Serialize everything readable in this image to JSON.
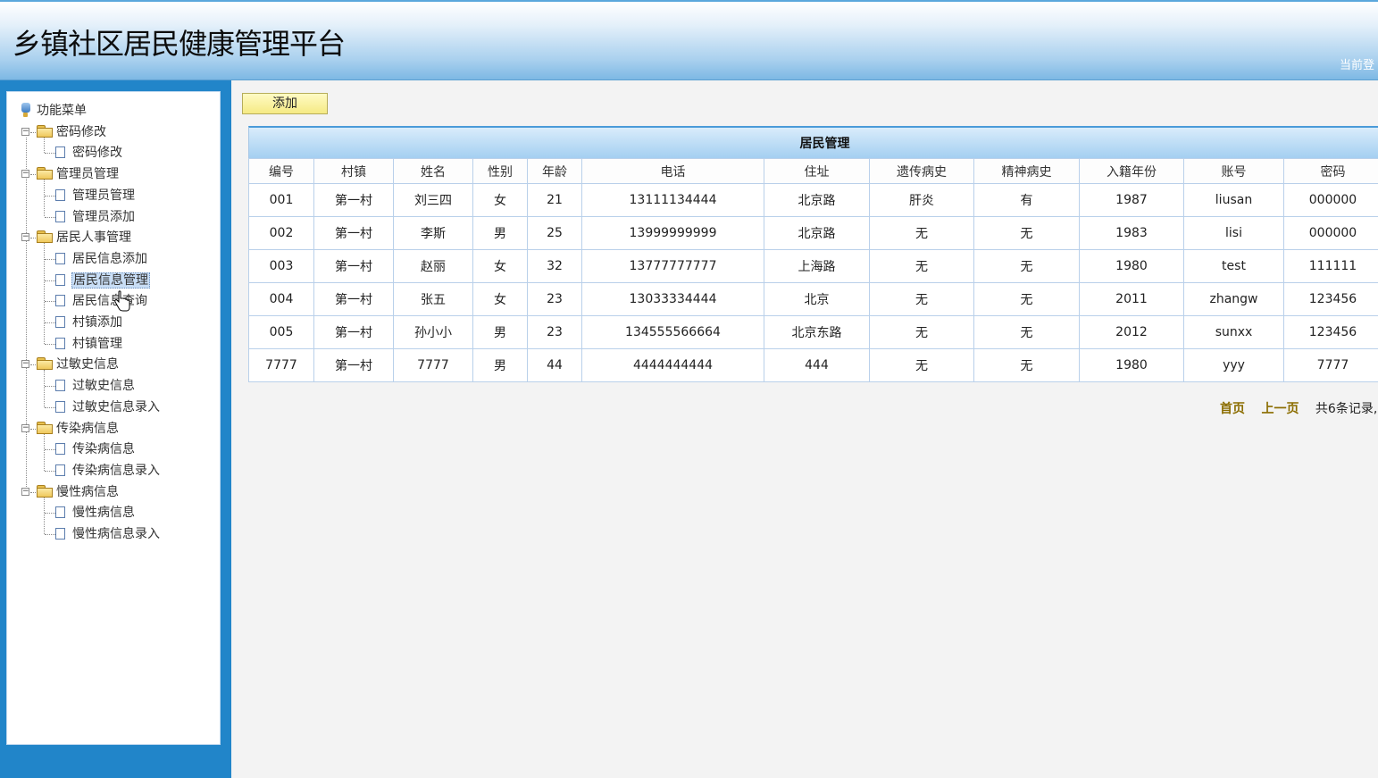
{
  "header": {
    "title": "乡镇社区居民健康管理平台",
    "login_info": "当前登"
  },
  "sidebar": {
    "root_label": "功能菜单",
    "groups": [
      {
        "label": "密码修改",
        "items": [
          "密码修改"
        ]
      },
      {
        "label": "管理员管理",
        "items": [
          "管理员管理",
          "管理员添加"
        ]
      },
      {
        "label": "居民人事管理",
        "items": [
          "居民信息添加",
          "居民信息管理",
          "居民信息查询",
          "村镇添加",
          "村镇管理"
        ]
      },
      {
        "label": "过敏史信息",
        "items": [
          "过敏史信息",
          "过敏史信息录入"
        ]
      },
      {
        "label": "传染病信息",
        "items": [
          "传染病信息",
          "传染病信息录入"
        ]
      },
      {
        "label": "慢性病信息",
        "items": [
          "慢性病信息",
          "慢性病信息录入"
        ]
      }
    ],
    "selected_item": "居民信息管理",
    "toggle_symbol": "−"
  },
  "main": {
    "add_label": "添加",
    "table": {
      "caption": "居民管理",
      "headers": [
        "编号",
        "村镇",
        "姓名",
        "性别",
        "年龄",
        "电话",
        "住址",
        "遗传病史",
        "精神病史",
        "入籍年份",
        "账号",
        "密码"
      ],
      "rows": [
        [
          "001",
          "第一村",
          "刘三四",
          "女",
          "21",
          "13111134444",
          "北京路",
          "肝炎",
          "有",
          "1987",
          "liusan",
          "000000"
        ],
        [
          "002",
          "第一村",
          "李斯",
          "男",
          "25",
          "13999999999",
          "北京路",
          "无",
          "无",
          "1983",
          "lisi",
          "000000"
        ],
        [
          "003",
          "第一村",
          "赵丽",
          "女",
          "32",
          "13777777777",
          "上海路",
          "无",
          "无",
          "1980",
          "test",
          "111111"
        ],
        [
          "004",
          "第一村",
          "张五",
          "女",
          "23",
          "13033334444",
          "北京",
          "无",
          "无",
          "2011",
          "zhangw",
          "123456"
        ],
        [
          "005",
          "第一村",
          "孙小小",
          "男",
          "23",
          "134555566664",
          "北京东路",
          "无",
          "无",
          "2012",
          "sunxx",
          "123456"
        ],
        [
          "7777",
          "第一村",
          "7777",
          "男",
          "44",
          "4444444444",
          "444",
          "无",
          "无",
          "1980",
          "yyy",
          "7777"
        ]
      ]
    },
    "pagination": {
      "first": "首页",
      "prev": "上一页",
      "summary": "共6条记录,"
    }
  }
}
